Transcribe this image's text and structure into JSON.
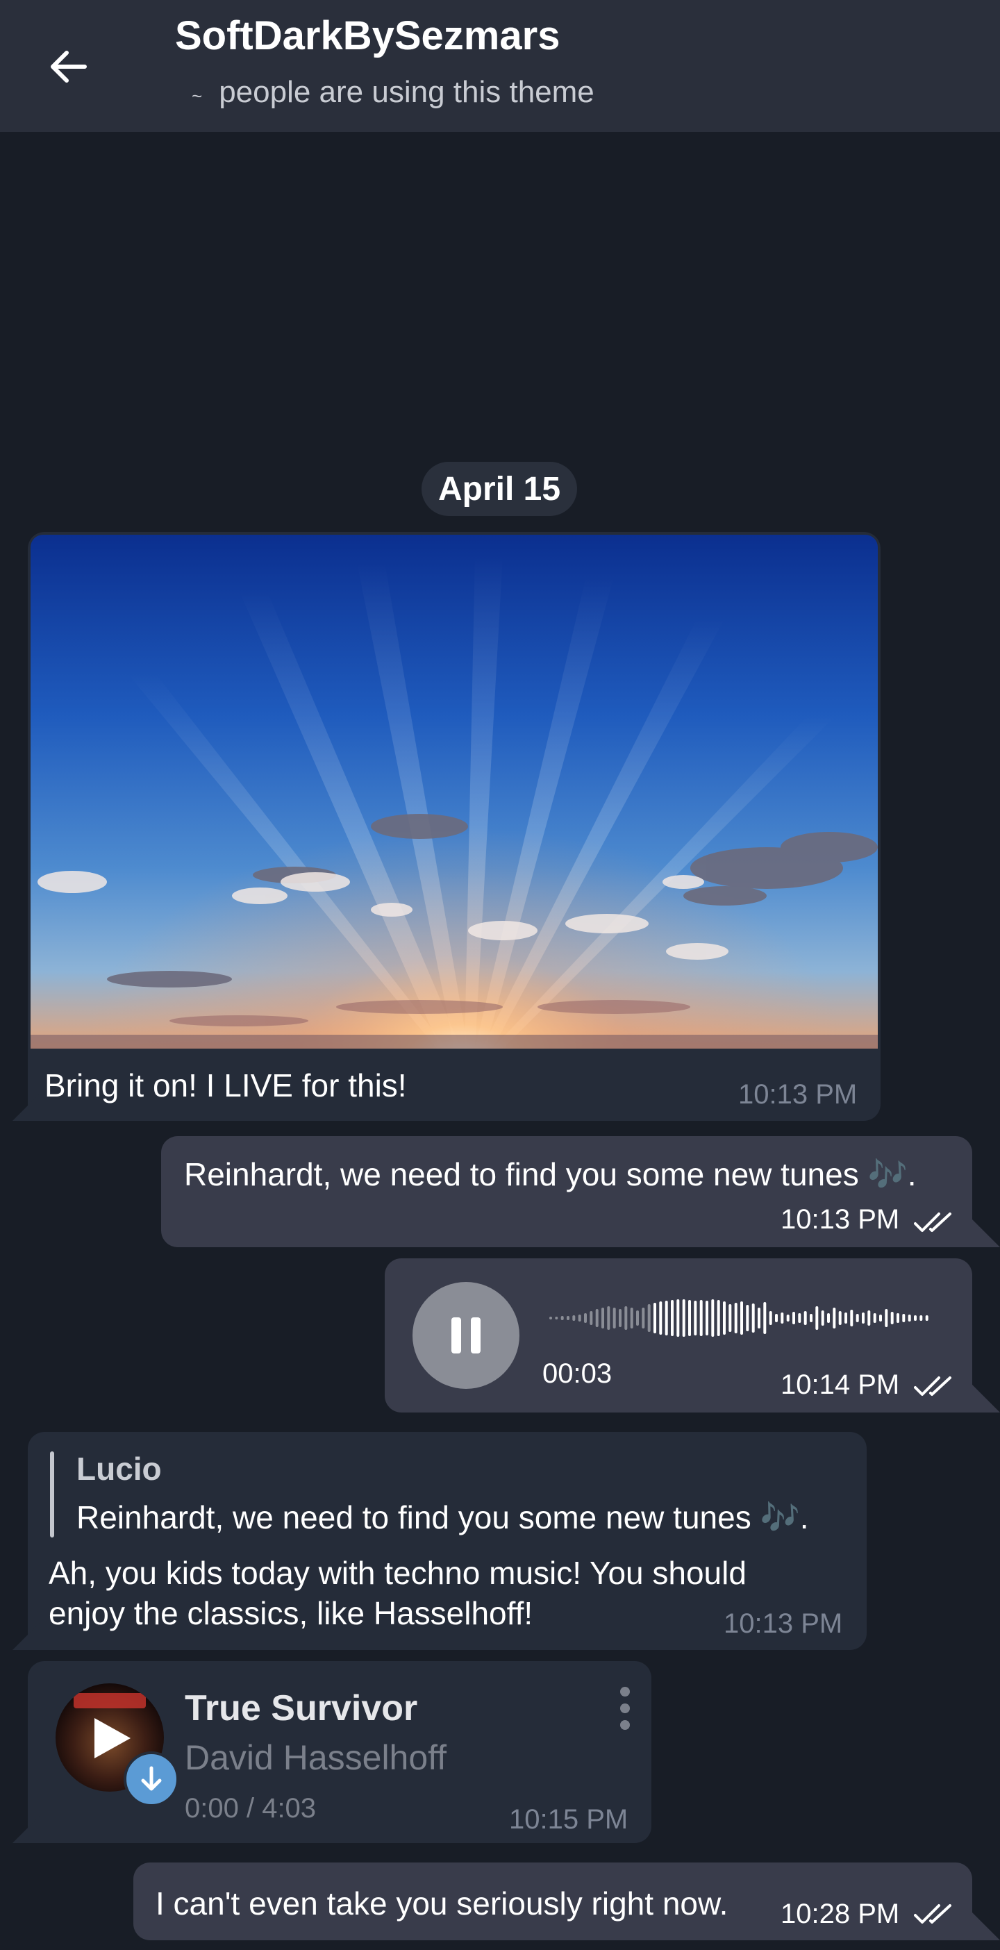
{
  "header": {
    "title": "SoftDarkBySezmars",
    "subtitle_prefix": "~",
    "subtitle": "people are using this theme"
  },
  "date_separator": "April 15",
  "messages": [
    {
      "type": "photo",
      "direction": "incoming",
      "caption": "Bring it on! I LIVE for this!",
      "time": "10:13 PM"
    },
    {
      "type": "text",
      "direction": "outgoing",
      "text": "Reinhardt, we need to find you some new tunes 🎶.",
      "time": "10:13 PM"
    },
    {
      "type": "voice",
      "direction": "outgoing",
      "duration": "00:03",
      "time": "10:14 PM"
    },
    {
      "type": "reply",
      "direction": "incoming",
      "reply_author": "Lucio",
      "reply_text": "Reinhardt, we need to find you some new tunes 🎶.",
      "line1": "Ah, you kids today with techno music! You should",
      "line2": "enjoy the classics, like Hasselhoff!",
      "time": "10:13 PM"
    },
    {
      "type": "audio",
      "direction": "incoming",
      "track_title": "True Survivor",
      "artist": "David Hasselhoff",
      "progress": "0:00 / 4:03",
      "time": "10:15 PM"
    },
    {
      "type": "text",
      "direction": "outgoing",
      "text": "I can't even take you seriously right now.",
      "time": "10:28 PM"
    }
  ],
  "colors": {
    "background": "#181d26",
    "header": "#2a2f3b",
    "bubble_incoming": "#252c39",
    "bubble_outgoing": "#393c4b",
    "accent": "#5b9bd5"
  },
  "icons": {
    "back": "arrow-left-icon",
    "read": "double-check-icon",
    "pause": "pause-icon",
    "play": "play-icon",
    "download": "download-icon",
    "menu": "more-vertical-icon"
  }
}
